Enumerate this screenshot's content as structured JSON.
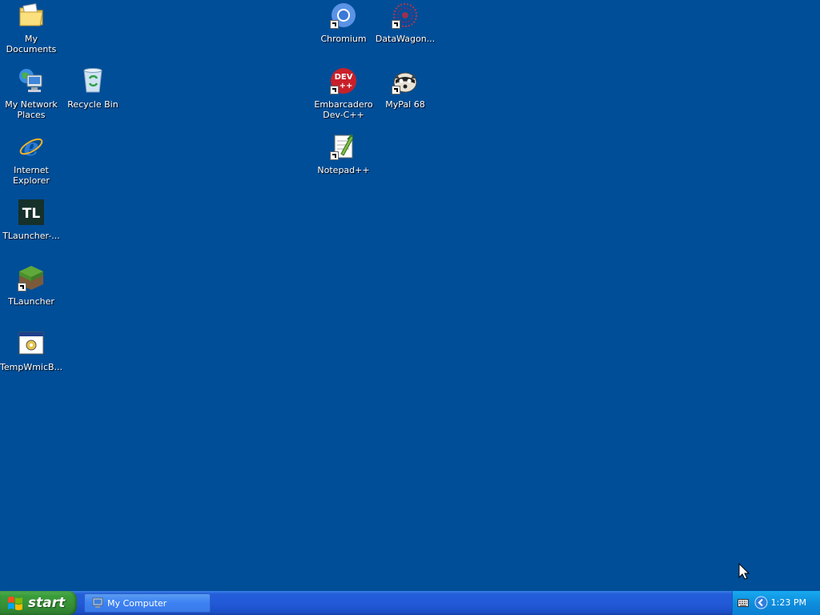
{
  "desktop": {
    "background_color": "#004e98",
    "icons": [
      {
        "label": "My Documents",
        "icon": "my-documents-icon",
        "shortcut": false
      },
      {
        "label": "My Network Places",
        "icon": "network-places-icon",
        "shortcut": false
      },
      {
        "label": "Recycle Bin",
        "icon": "recycle-bin-icon",
        "shortcut": false
      },
      {
        "label": "Internet Explorer",
        "icon": "internet-explorer-icon",
        "shortcut": false
      },
      {
        "label": "TLauncher-...",
        "icon": "tlauncher-tl-icon",
        "shortcut": false
      },
      {
        "label": "TLauncher",
        "icon": "tlauncher-grass-icon",
        "shortcut": true
      },
      {
        "label": "TempWmicB...",
        "icon": "batch-file-icon",
        "shortcut": false
      },
      {
        "label": "Chromium",
        "icon": "chromium-icon",
        "shortcut": true
      },
      {
        "label": "DataWagon...",
        "icon": "datawagon-icon",
        "shortcut": true
      },
      {
        "label": "Embarcadero Dev-C++",
        "icon": "devcpp-icon",
        "shortcut": true,
        "icon_text": "DEV\n++"
      },
      {
        "label": "MyPal 68",
        "icon": "mypal-icon",
        "shortcut": true
      },
      {
        "label": "Notepad++",
        "icon": "notepadpp-icon",
        "shortcut": true
      }
    ]
  },
  "taskbar": {
    "start_label": "start",
    "tasks": [
      {
        "label": "My Computer",
        "icon": "my-computer-icon",
        "active": false
      }
    ],
    "tray": {
      "icons": [
        "keyboard-icon",
        "show-hidden-icons-chevron-icon"
      ],
      "clock": "1:23 PM"
    }
  }
}
